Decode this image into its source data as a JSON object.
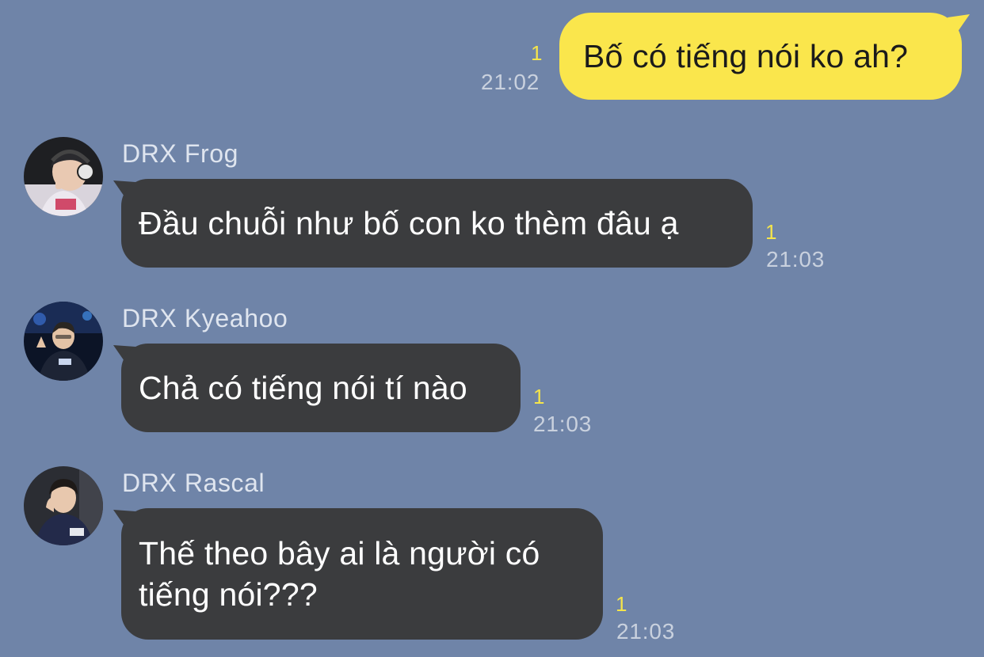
{
  "messages": [
    {
      "direction": "outgoing",
      "text": "Bố có tiếng nói ko ah?",
      "unread": "1",
      "time": "21:02"
    },
    {
      "direction": "incoming",
      "sender": "DRX Frog",
      "text": "Đầu chuỗi như bố con ko thèm đâu ạ",
      "unread": "1",
      "time": "21:03"
    },
    {
      "direction": "incoming",
      "sender": "DRX Kyeahoo",
      "text": "Chả có tiếng nói tí nào",
      "unread": "1",
      "time": "21:03"
    },
    {
      "direction": "incoming",
      "sender": "DRX Rascal",
      "text_line1": "Thế theo bây ai là người có",
      "text_line2": "tiếng nói???",
      "unread": "1",
      "time": "21:03"
    }
  ],
  "colors": {
    "background": "#6f84a8",
    "outgoing_bubble": "#fae64c",
    "incoming_bubble": "#3b3c3e",
    "unread_count": "#f5e54a",
    "timestamp": "#c9d1de",
    "sender_name": "#dfe5ef"
  }
}
